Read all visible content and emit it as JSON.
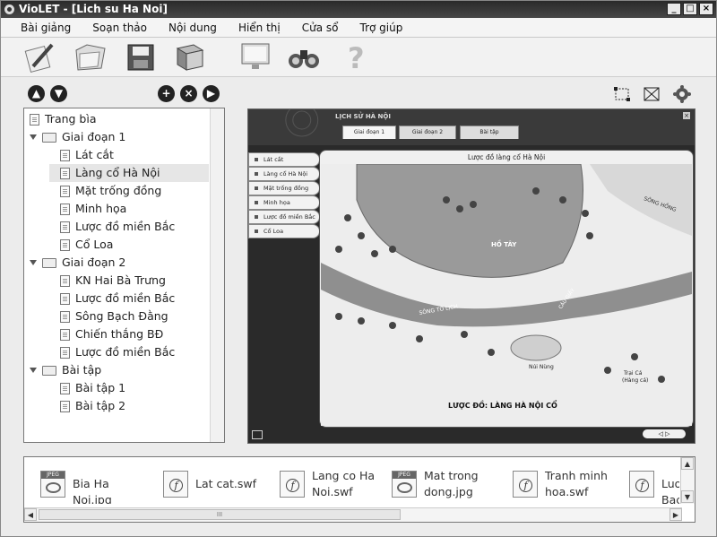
{
  "window": {
    "title": "VioLET - [Lich su Ha Noi]",
    "min": "_",
    "max": "□",
    "close": "×"
  },
  "menu": [
    "Bài giảng",
    "Soạn thảo",
    "Nội dung",
    "Hiển thị",
    "Cửa sổ",
    "Trợ giúp"
  ],
  "toolbar": [
    "pencil-icon",
    "folder-open-icon",
    "save-disk-icon",
    "cube-icon",
    "monitor-icon",
    "binoculars-icon",
    "help-question-icon"
  ],
  "tree": {
    "items": [
      {
        "label": "Trang bìa",
        "type": "page",
        "level": 0
      },
      {
        "label": "Giai đoạn 1",
        "type": "folder",
        "level": 0
      },
      {
        "label": "Lát cắt",
        "type": "page",
        "level": 1
      },
      {
        "label": "Làng cổ Hà Nội",
        "type": "page",
        "level": 1,
        "selected": true
      },
      {
        "label": "Mặt trống đồng",
        "type": "page",
        "level": 1
      },
      {
        "label": "Minh họa",
        "type": "page",
        "level": 1
      },
      {
        "label": "Lược đồ miền Bắc",
        "type": "page",
        "level": 1
      },
      {
        "label": "Cổ Loa",
        "type": "page",
        "level": 1
      },
      {
        "label": "Giai đoạn 2",
        "type": "folder",
        "level": 0
      },
      {
        "label": "KN Hai Bà Trưng",
        "type": "page",
        "level": 1
      },
      {
        "label": "Lược đồ miền Bắc",
        "type": "page",
        "level": 1
      },
      {
        "label": "Sông Bạch Đằng",
        "type": "page",
        "level": 1
      },
      {
        "label": "Chiến thắng BĐ",
        "type": "page",
        "level": 1
      },
      {
        "label": "Lược đồ miền Bắc",
        "type": "page",
        "level": 1
      },
      {
        "label": "Bài tập",
        "type": "folder",
        "level": 0
      },
      {
        "label": "Bài tập 1",
        "type": "page",
        "level": 1
      },
      {
        "label": "Bài tập 2",
        "type": "page",
        "level": 1
      }
    ]
  },
  "preview": {
    "title": "LỊCH SỬ HÀ NỘI",
    "tabs": [
      "Giai đoạn 1",
      "Giai đoạn 2",
      "Bài tập"
    ],
    "side": [
      "Lát cắt",
      "Làng cổ Hà Nội",
      "Mặt trống đồng",
      "Minh họa",
      "Lược đồ miền Bắc",
      "Cổ Loa"
    ],
    "map_heading": "Lược đồ làng cổ Hà Nội",
    "map_labels": {
      "lake": "HỒ TÂY",
      "river1": "SÔNG HỒNG",
      "river2": "SÔNG TÔ LỊCH",
      "hill": "Núi Nùng",
      "village": "Trại Cá",
      "village2": "(Hàng cá)",
      "caption": "LƯỢC ĐỒ: LÀNG HÀ NỘI CỔ",
      "dyke": "CÂU GIẤY"
    },
    "pager": "◁ ▷"
  },
  "files": [
    {
      "name": "Bia Ha Noi.jpg",
      "kind": "jpg"
    },
    {
      "name": "Lat cat.swf",
      "kind": "swf"
    },
    {
      "name": "Lang co Ha Noi.swf",
      "kind": "swf"
    },
    {
      "name": "Mat trong dong.jpg",
      "kind": "jpg"
    },
    {
      "name": "Tranh minh hoa.swf",
      "kind": "swf"
    },
    {
      "name": "Luoc Bac",
      "kind": "swf"
    }
  ],
  "file_tag": "JPEG",
  "scroll": {
    "grip": "III"
  }
}
